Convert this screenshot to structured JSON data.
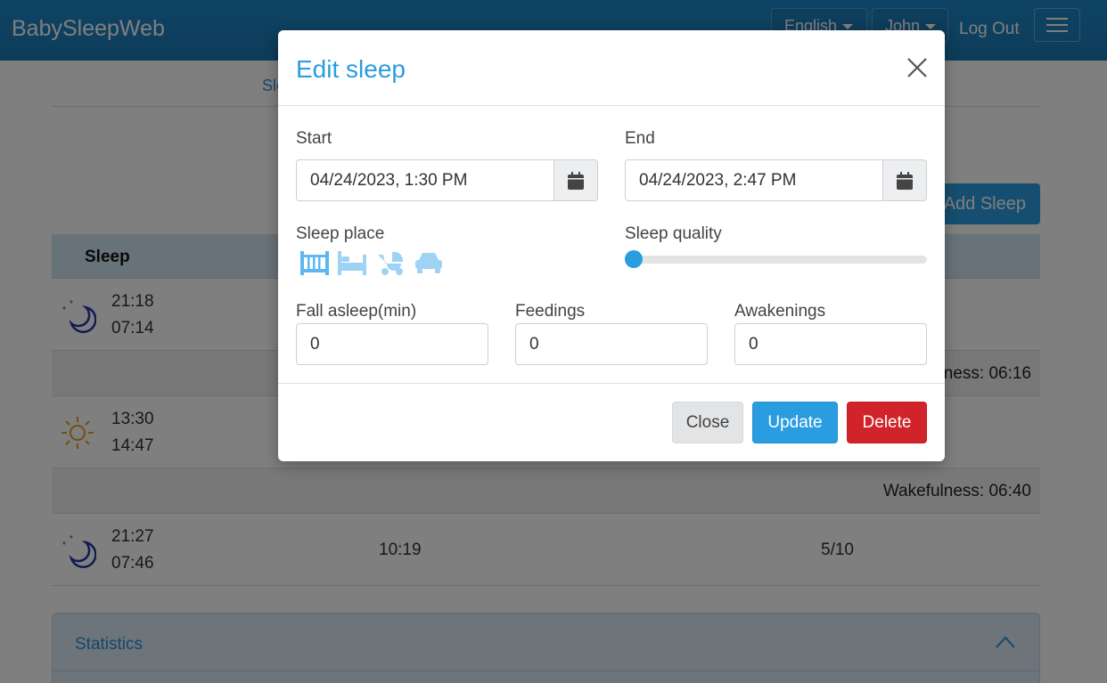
{
  "navbar": {
    "brand": "BabySleepWeb",
    "language": "English",
    "user": "John",
    "logout": "Log Out"
  },
  "page": {
    "tab_partial": "Sle",
    "add_sleep_label": "Add Sleep",
    "table_header": "Sleep",
    "rows": [
      {
        "type": "night",
        "start": "21:18",
        "end": "07:14"
      },
      {
        "wakefulness": "ness: 06:16"
      },
      {
        "type": "day",
        "start": "13:30",
        "end": "14:47"
      },
      {
        "wakefulness": "Wakefulness: 06:40"
      },
      {
        "type": "night",
        "start": "21:27",
        "end": "07:46",
        "duration": "10:19",
        "quality": "5/10"
      }
    ],
    "statistics_label": "Statistics"
  },
  "modal": {
    "title": "Edit sleep",
    "start_label": "Start",
    "start_value": "04/24/2023, 1:30 PM",
    "end_label": "End",
    "end_value": "04/24/2023, 2:47 PM",
    "sleep_place_label": "Sleep place",
    "sleep_places": [
      "crib-icon",
      "bed-icon",
      "stroller-icon",
      "car-icon"
    ],
    "sleep_quality_label": "Sleep quality",
    "sleep_quality_value": 0,
    "fall_asleep_label": "Fall asleep(min)",
    "fall_asleep_value": "0",
    "feedings_label": "Feedings",
    "feedings_value": "0",
    "awakenings_label": "Awakenings",
    "awakenings_value": "0",
    "close_label": "Close",
    "update_label": "Update",
    "delete_label": "Delete"
  },
  "colors": {
    "navbar": "#1e88c8",
    "primary": "#2a9de0",
    "danger": "#d0242a",
    "place_icon": "#9fd3f5"
  }
}
